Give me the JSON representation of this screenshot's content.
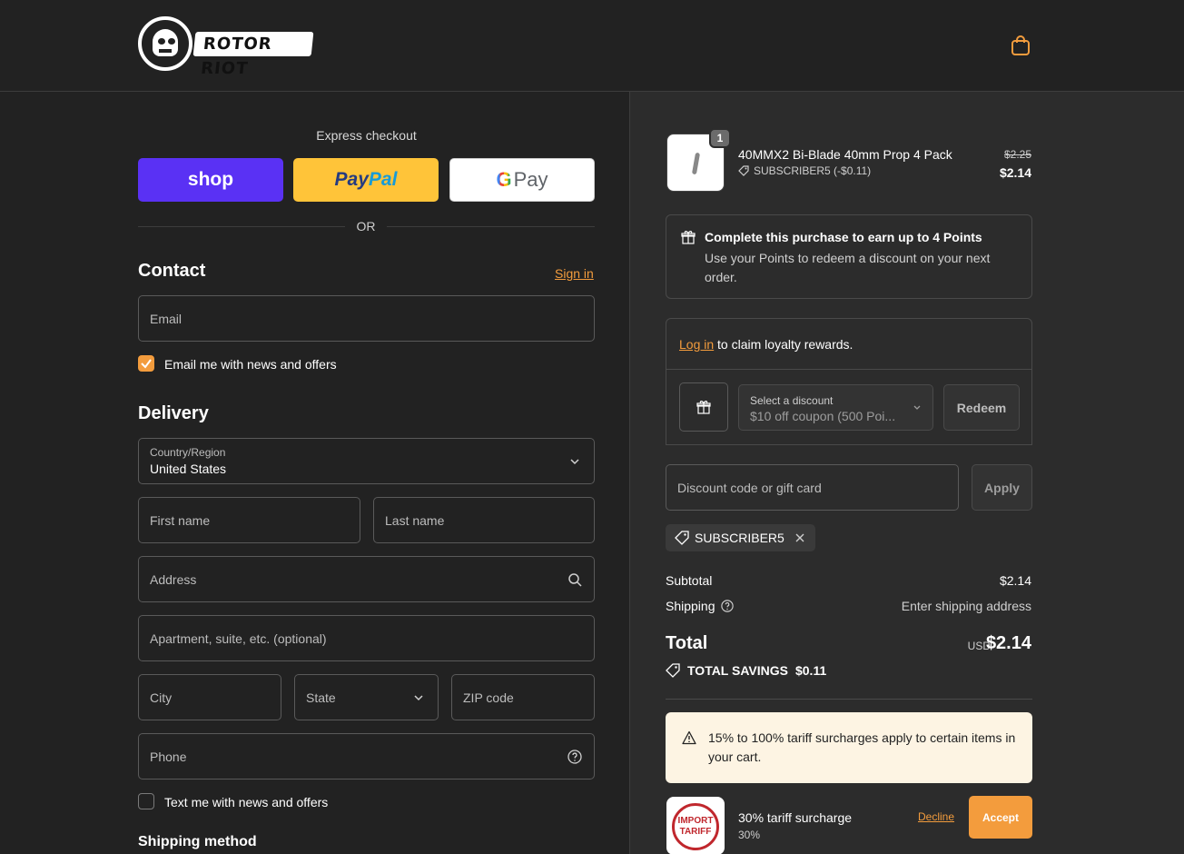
{
  "header": {
    "brand": "ROTOR RIOT",
    "cart_icon": "shopping-bag-icon",
    "accent": "#f39c3d"
  },
  "express": {
    "title": "Express checkout",
    "shop_label": "shop",
    "paypal_label_a": "Pay",
    "paypal_label_b": "Pal",
    "gpay_g": "G",
    "gpay_label": "Pay",
    "or_label": "OR"
  },
  "contact": {
    "title": "Contact",
    "signin_label": "Sign in",
    "email_placeholder": "Email",
    "email_news_label": "Email me with news and offers",
    "email_news_checked": true
  },
  "delivery": {
    "title": "Delivery",
    "country_label": "Country/Region",
    "country_value": "United States",
    "first_name": "First name",
    "last_name": "Last name",
    "address": "Address",
    "apartment": "Apartment, suite, etc. (optional)",
    "city": "City",
    "state": "State",
    "zip": "ZIP code",
    "phone": "Phone",
    "text_news_label": "Text me with news and offers",
    "text_news_checked": false
  },
  "shipping_method": {
    "title": "Shipping method"
  },
  "cart": {
    "item": {
      "quantity": "1",
      "name": "40MMX2 Bi-Blade 40mm Prop 4 Pack",
      "discount": "SUBSCRIBER5 (-$0.11)",
      "original_price": "$2.25",
      "price": "$2.14"
    }
  },
  "points": {
    "title": "Complete this purchase to earn up to 4 Points",
    "text": "Use your Points to redeem a discount on your next order."
  },
  "loyalty": {
    "login_link": "Log in",
    "login_text": "to claim loyalty rewards.",
    "select_label": "Select a discount",
    "select_value": "$10 off coupon (500 Poi...",
    "redeem_label": "Redeem"
  },
  "discount": {
    "placeholder": "Discount code or gift card",
    "apply_label": "Apply",
    "applied_code": "SUBSCRIBER5"
  },
  "summary": {
    "subtotal_label": "Subtotal",
    "subtotal_value": "$2.14",
    "shipping_label": "Shipping",
    "shipping_value": "Enter shipping address",
    "total_label": "Total",
    "currency": "USD",
    "total_value": "$2.14",
    "savings_label": "TOTAL SAVINGS",
    "savings_value": "$0.11"
  },
  "tariff": {
    "warning": "15% to 100% tariff surcharges apply to certain items in your cart.",
    "seal_line1": "IMPORT",
    "seal_line2": "TARIFF",
    "name": "30% tariff surcharge",
    "percent": "30%",
    "decline_label": "Decline",
    "accept_label": "Accept"
  }
}
